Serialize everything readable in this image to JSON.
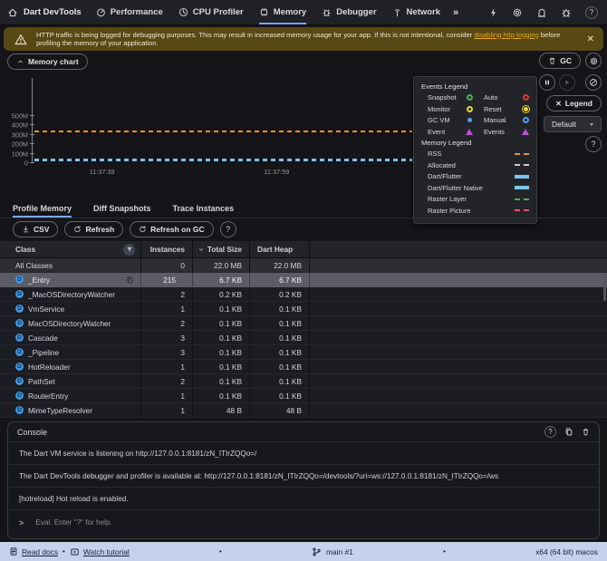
{
  "topbar": {
    "title": "Dart DevTools",
    "tabs": [
      {
        "label": "Performance",
        "selected": false
      },
      {
        "label": "CPU Profiler",
        "selected": false
      },
      {
        "label": "Memory",
        "selected": true
      },
      {
        "label": "Debugger",
        "selected": false
      },
      {
        "label": "Network",
        "selected": false
      }
    ],
    "overflow_label": "»"
  },
  "banner": {
    "text_before_link": "HTTP traffic is being logged for debugging purposes. This may result in increased memory usage for your app. If this is not intentional, consider ",
    "link_text": "disabling http logging",
    "text_after_link": " before profiling the memory of your application.",
    "close_label": "✕"
  },
  "chart": {
    "collapse_button_label": "Memory chart",
    "gc_button_label": "GC",
    "legend_button_label": "Legend",
    "legend_close_glyph": "✕",
    "interval_dropdown_value": "Default",
    "legend_panel": {
      "events_title": "Events Legend",
      "events": [
        {
          "label": "Snapshot",
          "glyph": "ring",
          "color": "#46b253"
        },
        {
          "label": "Auto",
          "glyph": "ring",
          "color": "#e23b33"
        },
        {
          "label": "Monitor",
          "glyph": "ring",
          "color": "#e8d935"
        },
        {
          "label": "Reset",
          "glyph": "dot-ring",
          "color": "#e8d935"
        },
        {
          "label": "GC VM",
          "glyph": "dot",
          "color": "#4fa3e8"
        },
        {
          "label": "Manual",
          "glyph": "ring",
          "color": "#4fa3e8"
        },
        {
          "label": "Event",
          "glyph": "triangle",
          "color": "#c14bd8"
        },
        {
          "label": "Events",
          "glyph": "triangle",
          "color": "#c14bd8"
        }
      ],
      "memory_title": "Memory Legend",
      "memory": [
        {
          "label": "RSS",
          "glyph": "dashed",
          "color": "#e8913c"
        },
        {
          "label": "Allocated",
          "glyph": "dashed",
          "color": "#c9cacd"
        },
        {
          "label": "Dart/Flutter",
          "glyph": "solid",
          "color": "#7cc4ec"
        },
        {
          "label": "Dart/Flutter Native",
          "glyph": "solid",
          "color": "#7cc4ec"
        },
        {
          "label": "Raster Layer",
          "glyph": "dashed",
          "color": "#3fb54c"
        },
        {
          "label": "Raster Picture",
          "glyph": "dashed",
          "color": "#e85465"
        }
      ]
    }
  },
  "chart_data": {
    "type": "line",
    "title": "Memory chart",
    "ylim": [
      0,
      900
    ],
    "y_ticks": [
      {
        "label": "500M",
        "value": 500
      },
      {
        "label": "400M",
        "value": 400
      },
      {
        "label": "300M",
        "value": 300
      },
      {
        "label": "200M",
        "value": 200
      },
      {
        "label": "100M",
        "value": 100
      },
      {
        "label": "0",
        "value": 0
      }
    ],
    "x_tick_labels": [
      {
        "label": "11:37:39",
        "pos_pct": 18.3
      },
      {
        "label": "11:37:59",
        "pos_pct": 64.3
      }
    ],
    "series": [
      {
        "name": "RSS",
        "value": 330,
        "color": "#e8913c",
        "style": "dashed",
        "thickness": 2
      },
      {
        "name": "Allocated",
        "value": 36,
        "color": "#c9cacd",
        "style": "dashed",
        "thickness": 1
      },
      {
        "name": "Dart/Flutter",
        "value": 24,
        "color": "#7cc4ec",
        "style": "dashed",
        "thickness": 3
      }
    ]
  },
  "profile_tabs": [
    {
      "label": "Profile Memory",
      "selected": true
    },
    {
      "label": "Diff Snapshots",
      "selected": false
    },
    {
      "label": "Trace Instances",
      "selected": false
    }
  ],
  "toolbar": {
    "csv_label": "CSV",
    "refresh_label": "Refresh",
    "refresh_on_gc_label": "Refresh on GC"
  },
  "table": {
    "columns": [
      "Class",
      "Instances",
      "Total Size",
      "Dart Heap"
    ],
    "sorted_column": "Total Size",
    "sort_direction": "desc",
    "rows": [
      {
        "class": "All Classes",
        "instances": "0",
        "total_size": "22.0 MB",
        "dart_heap": "22.0 MB",
        "kind": "all"
      },
      {
        "class": "_Entry",
        "instances": "215",
        "total_size": "6.7 KB",
        "dart_heap": "6.7 KB",
        "selected": true
      },
      {
        "class": "_MacOSDirectoryWatcher",
        "instances": "2",
        "total_size": "0.2 KB",
        "dart_heap": "0.2 KB"
      },
      {
        "class": "VmService",
        "instances": "1",
        "total_size": "0.1 KB",
        "dart_heap": "0.1 KB"
      },
      {
        "class": "MacOSDirectoryWatcher",
        "instances": "2",
        "total_size": "0.1 KB",
        "dart_heap": "0.1 KB"
      },
      {
        "class": "Cascade",
        "instances": "3",
        "total_size": "0.1 KB",
        "dart_heap": "0.1 KB"
      },
      {
        "class": "_Pipeline",
        "instances": "3",
        "total_size": "0.1 KB",
        "dart_heap": "0.1 KB"
      },
      {
        "class": "HotReloader",
        "instances": "1",
        "total_size": "0.1 KB",
        "dart_heap": "0.1 KB"
      },
      {
        "class": "PathSet",
        "instances": "2",
        "total_size": "0.1 KB",
        "dart_heap": "0.1 KB"
      },
      {
        "class": "RouterEntry",
        "instances": "1",
        "total_size": "0.1 KB",
        "dart_heap": "0.1 KB"
      },
      {
        "class": "MimeTypeResolver",
        "instances": "1",
        "total_size": "48 B",
        "dart_heap": "48 B"
      }
    ]
  },
  "console": {
    "title": "Console",
    "lines": [
      "The Dart VM service is listening on http://127.0.0.1:8181/zN_ITIrZQQo=/",
      "The Dart DevTools debugger and profiler is available at: http://127.0.0.1:8181/zN_ITIrZQQo=/devtools/?uri=ws://127.0.0.1:8181/zN_ITIrZQQo=/ws",
      "[hotreload] Hot reload is enabled."
    ],
    "prompt_caret": ">",
    "prompt_placeholder": "Eval. Enter \"?\" for help."
  },
  "statusbar": {
    "read_docs_label": "Read docs",
    "watch_tutorial_label": "Watch tutorial",
    "separator": "•",
    "connection_label": "main #1",
    "platform_label": "x64 (64 bit) macos"
  }
}
